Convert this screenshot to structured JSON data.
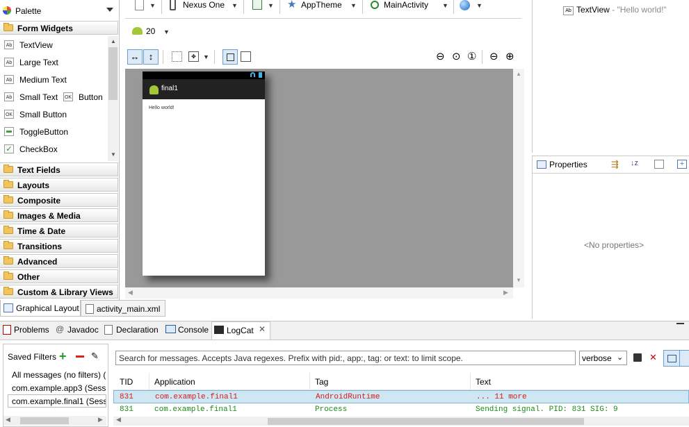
{
  "palette": {
    "title": "Palette",
    "form_widgets_label": "Form Widgets",
    "widgets": [
      {
        "icon": "Ab",
        "label": "TextView"
      },
      {
        "icon": "Ab",
        "label": "Large Text"
      },
      {
        "icon": "Ab",
        "label": "Medium Text"
      },
      {
        "icon": "Ab",
        "label": "Small Text"
      },
      {
        "icon": "OK",
        "label": "Button"
      },
      {
        "icon": "OK",
        "label": "Small Button"
      },
      {
        "icon": "",
        "label": "ToggleButton"
      },
      {
        "icon": "",
        "label": "CheckBox"
      }
    ],
    "sections": [
      "Text Fields",
      "Layouts",
      "Composite",
      "Images & Media",
      "Time & Date",
      "Transitions",
      "Advanced",
      "Other",
      "Custom & Library Views"
    ]
  },
  "toolbar": {
    "device": "Nexus One",
    "theme": "AppTheme",
    "activity": "MainActivity",
    "api_level": "20"
  },
  "preview": {
    "app_title": "final1",
    "content_text": "Hello world!"
  },
  "editor_tabs": {
    "graphical": "Graphical Layout",
    "xml": "activity_main.xml"
  },
  "outline": {
    "item_icon": "Ab",
    "item_name": "TextView",
    "item_value": " - \"Hello world!\""
  },
  "properties": {
    "title": "Properties",
    "empty": "<No properties>"
  },
  "bottom_tabs": [
    "Problems",
    "Javadoc",
    "Declaration",
    "Console",
    "LogCat"
  ],
  "logcat": {
    "saved_filters_label": "Saved Filters",
    "filters": [
      "All messages (no filters) (",
      "com.example.app3 (Sessi",
      "com.example.final1 (Sess"
    ],
    "search_placeholder": "Search for messages. Accepts Java regexes. Prefix with pid:, app:, tag: or text: to limit scope.",
    "level": "verbose",
    "columns": [
      "TID",
      "Application",
      "Tag",
      "Text"
    ],
    "rows": [
      {
        "tid": "831",
        "app": "com.example.final1",
        "tag": "AndroidRuntime",
        "text": "... 11 more",
        "color": "#d01c1c",
        "selected": true
      },
      {
        "tid": "831",
        "app": "com.example.final1",
        "tag": "Process",
        "text": "Sending signal. PID: 831 SIG: 9",
        "color": "#1c8a1c",
        "selected": false
      }
    ]
  },
  "colors": {
    "canvas": "#999999",
    "selection": "#cfe7f2",
    "android_green": "#a4c639"
  }
}
